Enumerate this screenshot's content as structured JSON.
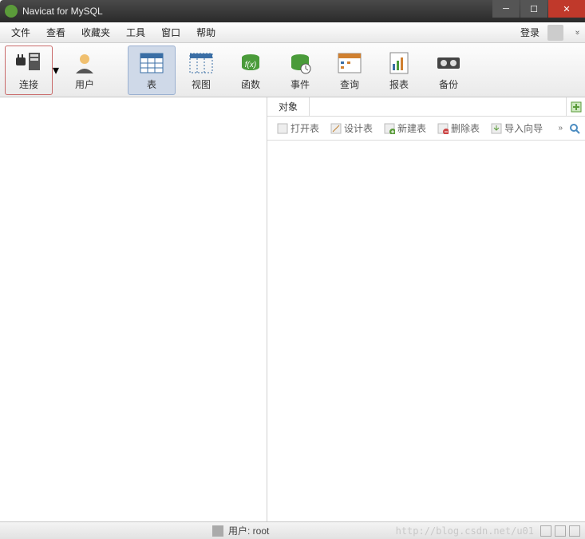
{
  "title": "Navicat for MySQL",
  "menu": {
    "file": "文件",
    "view": "查看",
    "favorites": "收藏夹",
    "tools": "工具",
    "window": "窗口",
    "help": "帮助",
    "login": "登录"
  },
  "toolbar": {
    "connection": "连接",
    "user": "用户",
    "table": "表",
    "viewitem": "视图",
    "function": "函数",
    "event": "事件",
    "query": "查询",
    "report": "报表",
    "backup": "备份"
  },
  "object_tab": "对象",
  "actions": {
    "open": "打开表",
    "design": "设计表",
    "new": "新建表",
    "delete": "删除表",
    "import": "导入向导"
  },
  "status": {
    "user_label": "用户: root"
  },
  "watermark": "http://blog.csdn.net/u01"
}
